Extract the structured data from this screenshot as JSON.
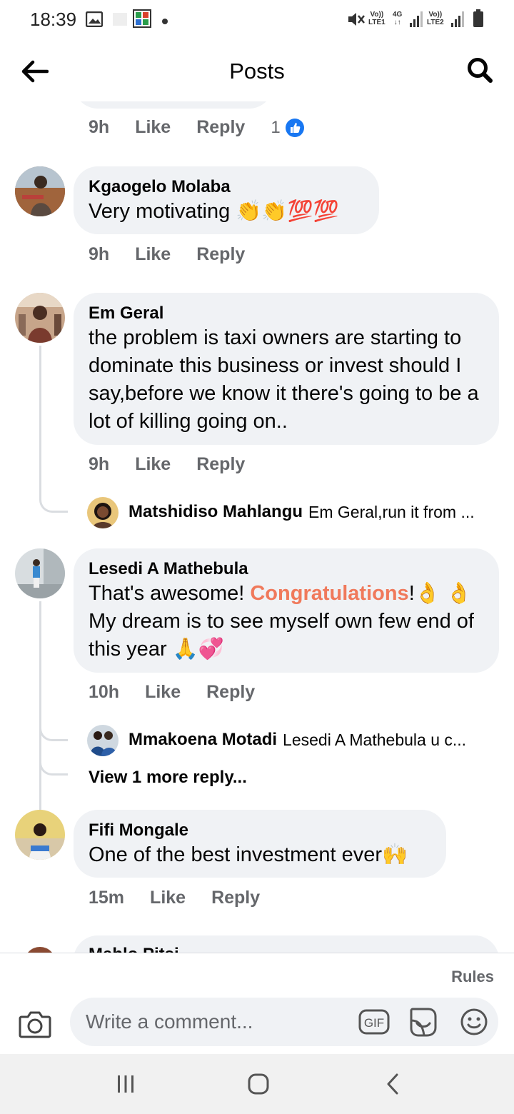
{
  "status_bar": {
    "time": "18:39",
    "volte1": "Vo))",
    "lte1": "LTE1",
    "net4g": "4G",
    "volte2": "Vo))",
    "lte2": "LTE2"
  },
  "header": {
    "title": "Posts",
    "back_icon": "arrow-left-icon",
    "search_icon": "search-icon"
  },
  "top_meta": {
    "time": "9h",
    "like": "Like",
    "reply": "Reply",
    "reaction_count": "1"
  },
  "comments": [
    {
      "author": "Kgaogelo Molaba",
      "text": "Very motivating 👏👏💯💯",
      "time": "9h",
      "like": "Like",
      "reply": "Reply"
    },
    {
      "author": "Em Geral",
      "text": "the problem is taxi owners are starting to dominate this business or invest should I say,before we know it there's going to be a lot of killing going on..",
      "time": "9h",
      "like": "Like",
      "reply": "Reply",
      "reply_preview": {
        "author": "Matshidiso Mahlangu",
        "snippet": "Em Geral,run it from ..."
      }
    },
    {
      "author": "Lesedi A Mathebula",
      "text_before": "That's awesome! ",
      "text_highlight": "Congratulations",
      "text_after": "!👌 👌 My dream is to see myself own few end of this year 🙏💞",
      "time": "10h",
      "like": "Like",
      "reply": "Reply",
      "reply_preview": {
        "author": "Mmakoena Motadi",
        "snippet": "Lesedi A Mathebula u c..."
      },
      "view_more": "View 1 more reply..."
    },
    {
      "author": "Fifi Mongale",
      "text": "One of the best investment ever🙌",
      "time": "15m",
      "like": "Like",
      "reply": "Reply"
    },
    {
      "author": "Mahlo Pitsi"
    }
  ],
  "composer": {
    "rules": "Rules",
    "placeholder": "Write a comment...",
    "gif": "GIF",
    "camera_icon": "camera-icon",
    "sticker_icon": "sticker-icon",
    "emoji_icon": "smiley-icon"
  },
  "nav": {
    "recents_icon": "recents-icon",
    "home_icon": "home-icon",
    "back_icon": "nav-back-icon"
  },
  "colors": {
    "bubble": "#f0f2f5",
    "meta_gray": "#65676b",
    "highlight": "#f0795b",
    "like_blue": "#1877f2"
  }
}
